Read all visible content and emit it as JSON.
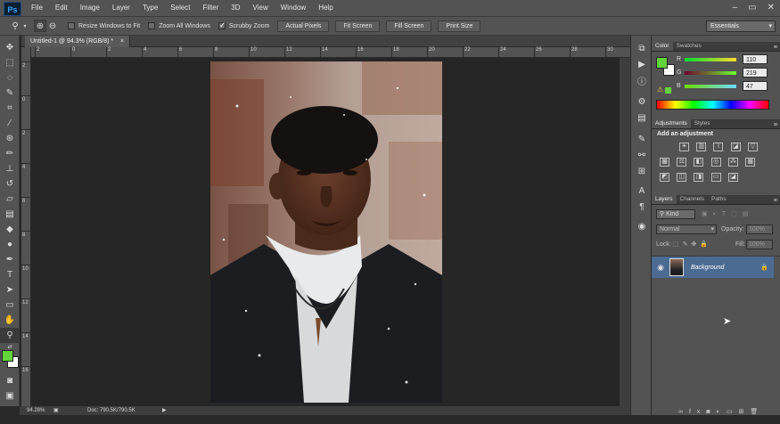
{
  "app": {
    "logo": "Ps",
    "accent": "#31a8ff"
  },
  "menu": [
    "File",
    "Edit",
    "Image",
    "Layer",
    "Type",
    "Select",
    "Filter",
    "3D",
    "View",
    "Window",
    "Help"
  ],
  "window_controls": {
    "minimize_icon": "minimize-icon",
    "maximize_icon": "maximize-icon",
    "close_icon": "close-icon"
  },
  "options": {
    "resize_windows": "Resize Windows to Fit",
    "zoom_all_windows": "Zoom All Windows",
    "scrubby_zoom": "Scrubby Zoom",
    "resize_checked": false,
    "zoom_all_checked": false,
    "scrubby_checked": true,
    "buttons": [
      "Actual Pixels",
      "Fit Screen",
      "Fill Screen",
      "Print Size"
    ],
    "workspace": "Essentials"
  },
  "document": {
    "tab_title": "Untitled-1 @ 94.3% (RGB/8) *",
    "close_icon": "close-icon"
  },
  "ruler_ticks": [
    "2",
    "0",
    "2",
    "4",
    "6",
    "8",
    "10",
    "12",
    "14",
    "16",
    "18",
    "20",
    "22",
    "24",
    "26",
    "28",
    "30"
  ],
  "status": {
    "zoom": "94.28%",
    "doc": "Doc: 790.5K/790.5K"
  },
  "color_panel": {
    "tabs": [
      "Color",
      "Swatches"
    ],
    "fg_color": "#64d23a",
    "bg_color": "#ffffff",
    "channels": [
      {
        "label": "R",
        "value": "110"
      },
      {
        "label": "G",
        "value": "219"
      },
      {
        "label": "B",
        "value": "47"
      }
    ]
  },
  "adjustments_panel": {
    "tabs": [
      "Adjustments",
      "Styles"
    ],
    "heading": "Add an adjustment"
  },
  "layers_panel": {
    "tabs": [
      "Layers",
      "Channels",
      "Paths"
    ],
    "filter": "Kind",
    "blend_mode": "Normal",
    "opacity_label": "Opacity:",
    "opacity_value": "100%",
    "lock_label": "Lock:",
    "fill_label": "Fill:",
    "fill_value": "100%",
    "layers": [
      {
        "name": "Background",
        "visible": true,
        "locked": true
      }
    ]
  }
}
